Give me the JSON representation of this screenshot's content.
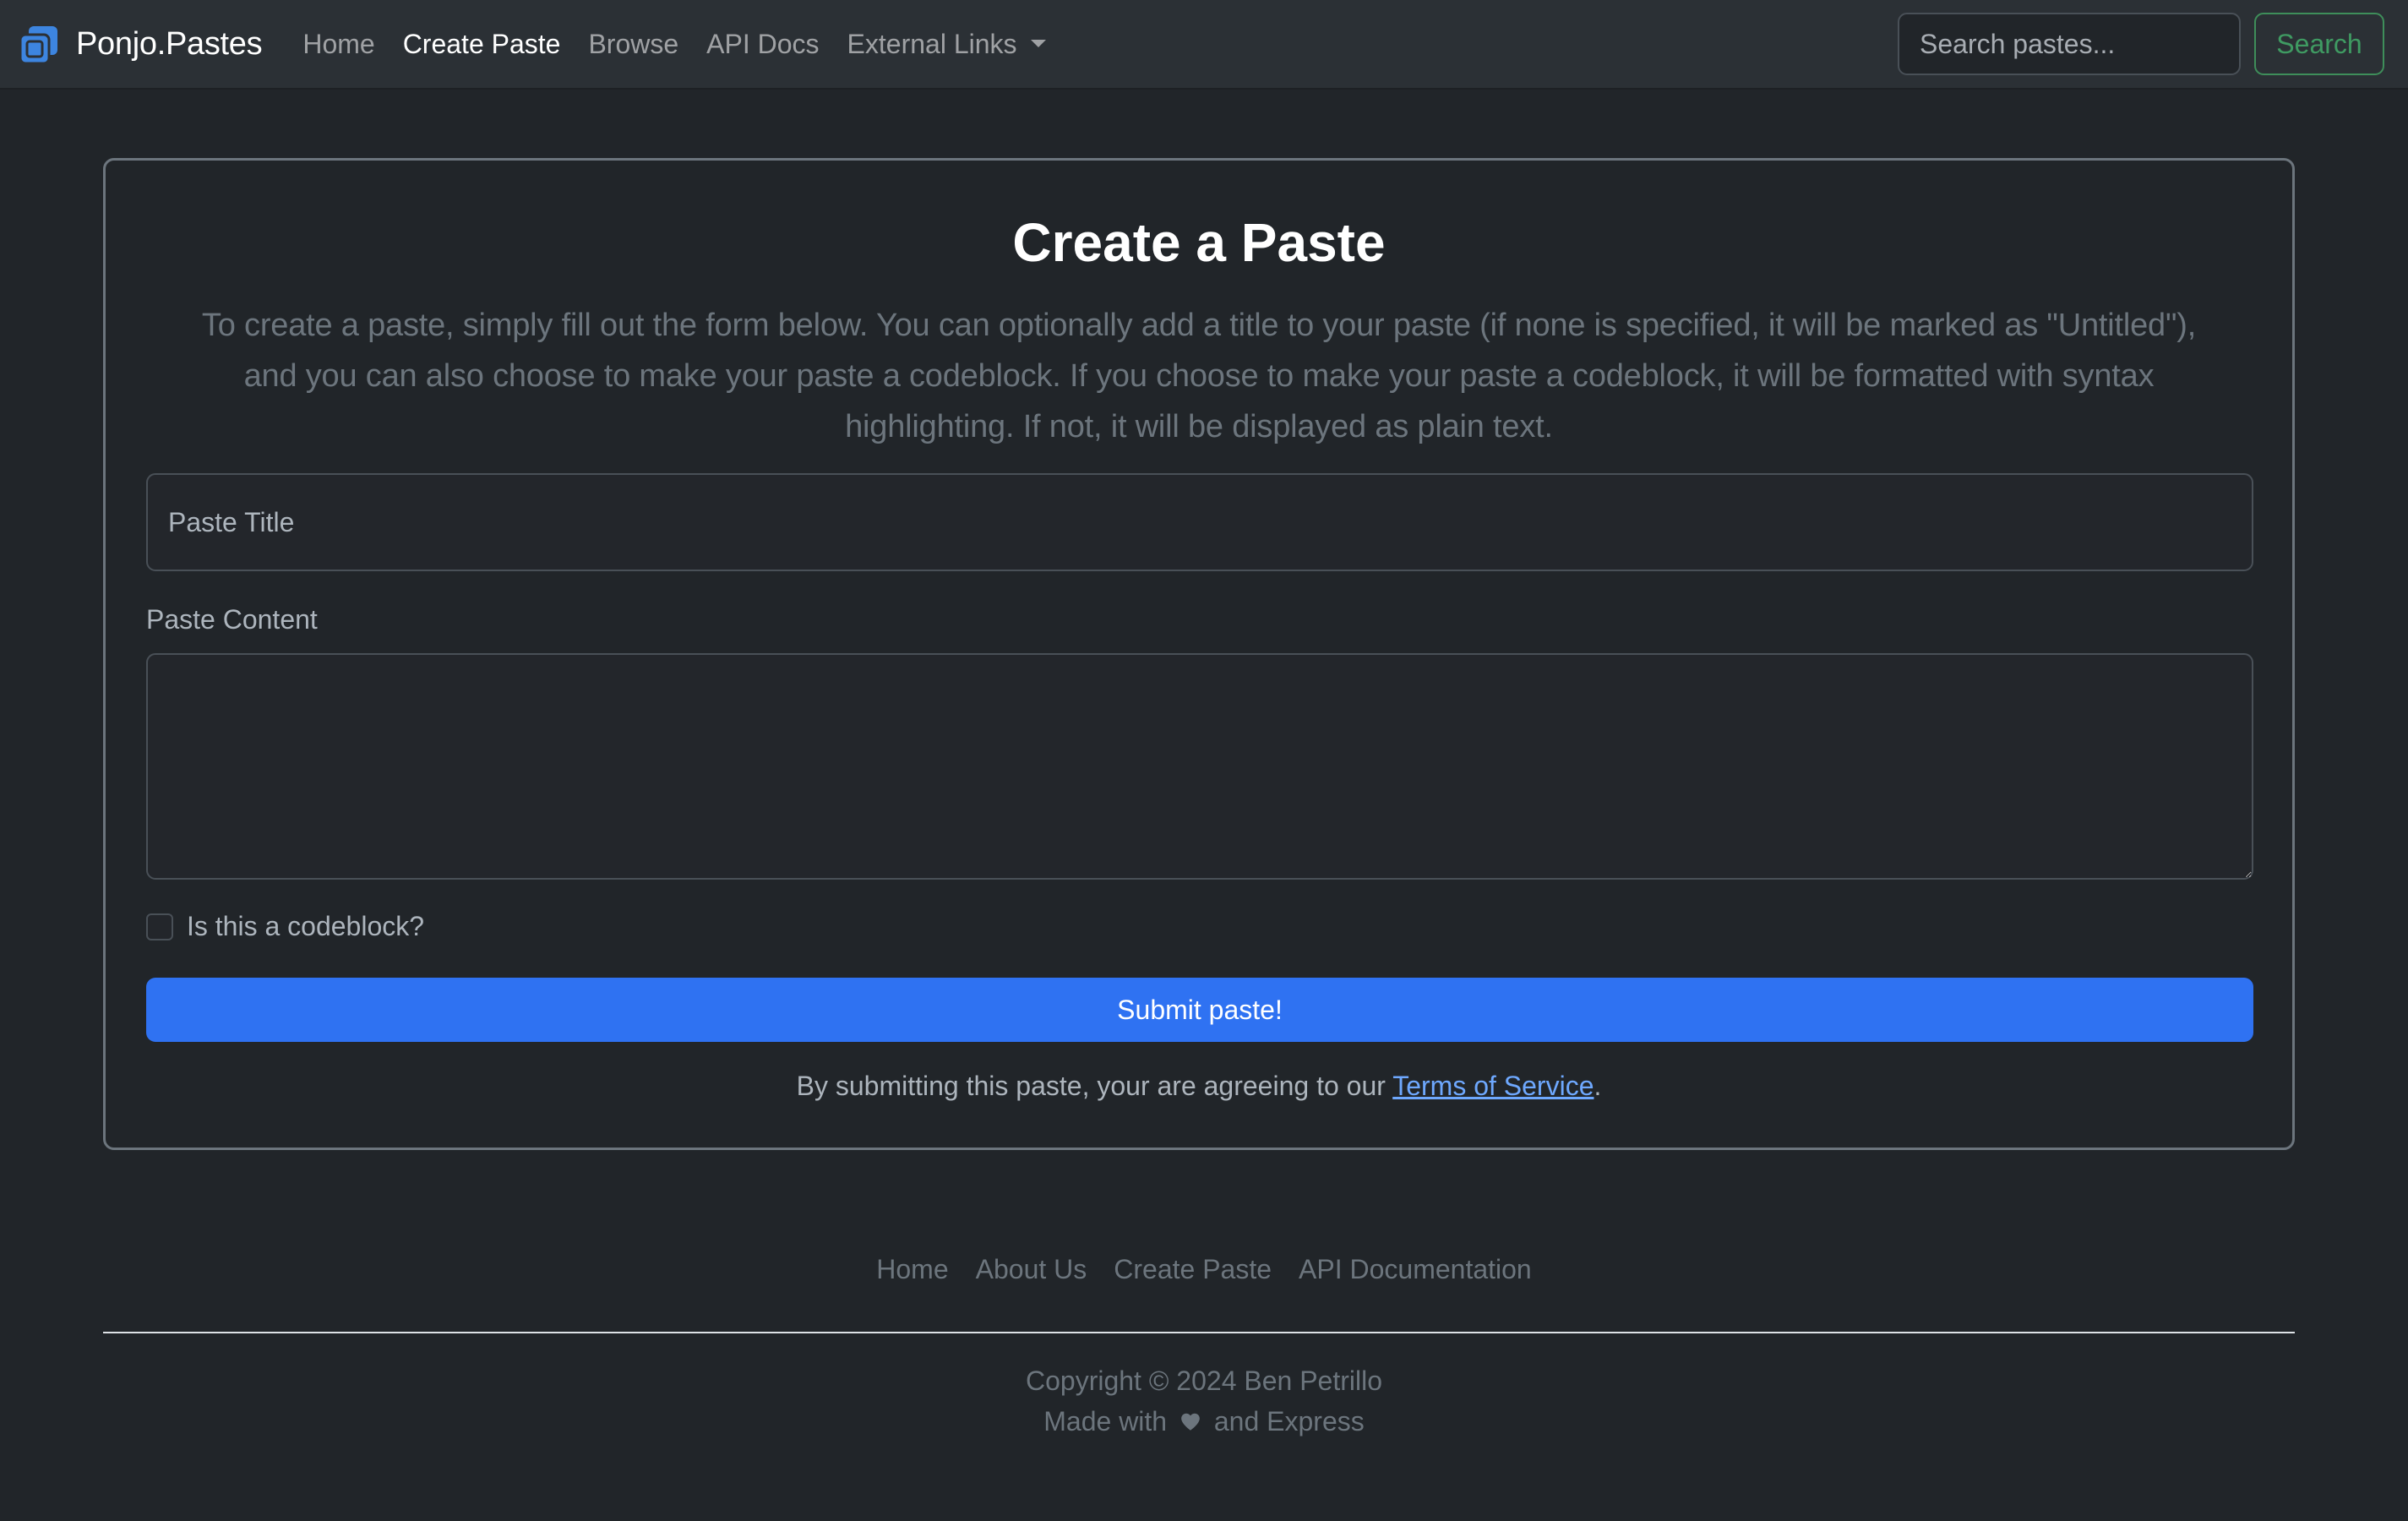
{
  "navbar": {
    "brand": "Ponjo.Pastes",
    "brand_icon": "copy-icon",
    "links": [
      {
        "label": "Home",
        "active": false
      },
      {
        "label": "Create Paste",
        "active": true
      },
      {
        "label": "Browse",
        "active": false
      },
      {
        "label": "API Docs",
        "active": false
      },
      {
        "label": "External Links",
        "active": false,
        "dropdown": true
      }
    ],
    "search": {
      "placeholder": "Search pastes...",
      "value": "",
      "button_label": "Search"
    }
  },
  "form": {
    "title": "Create a Paste",
    "intro": "To create a paste, simply fill out the form below. You can optionally add a title to your paste (if none is specified, it will be marked as \"Untitled\"), and you can also choose to make your paste a codeblock. If you choose to make your paste a codeblock, it will be formatted with syntax highlighting. If not, it will be displayed as plain text.",
    "title_input": {
      "placeholder": "Paste Title",
      "value": ""
    },
    "content_label": "Paste Content",
    "content_input": {
      "value": ""
    },
    "codeblock_checkbox": {
      "label": "Is this a codeblock?",
      "checked": false
    },
    "submit_label": "Submit paste!",
    "tos_prefix": "By submitting this paste, your are agreeing to our ",
    "tos_link": "Terms of Service",
    "tos_suffix": "."
  },
  "footer": {
    "links": [
      "Home",
      "About Us",
      "Create Paste",
      "API Documentation"
    ],
    "copyright": "Copyright © 2024 Ben Petrillo",
    "made_with_prefix": "Made with",
    "made_with_icon": "heart-icon",
    "made_with_suffix": "and Express"
  },
  "colors": {
    "primary": "#2f72f2",
    "success_outline": "#3f9a62",
    "link": "#6ea8fe",
    "brand_icon": "#3d85e0"
  }
}
